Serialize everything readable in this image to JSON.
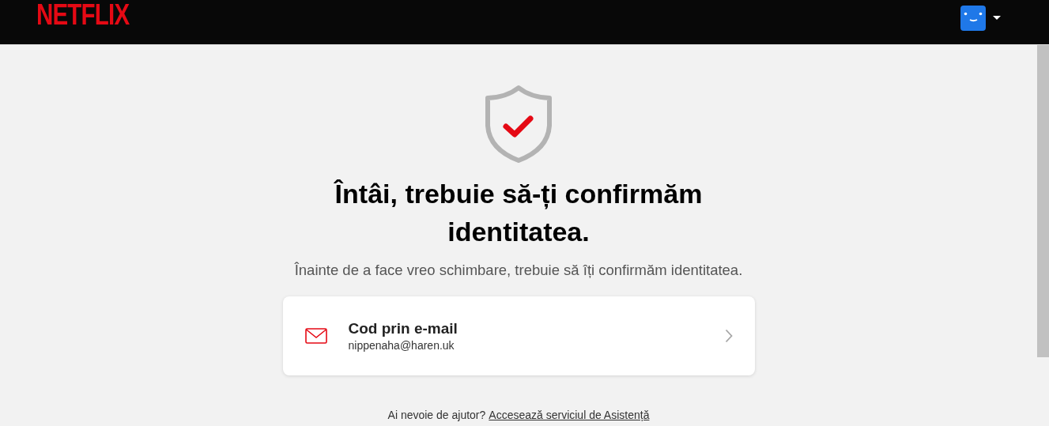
{
  "header": {
    "logo": "NETFLIX"
  },
  "title": "Întâi, trebuie să-ți confirmăm identitatea.",
  "subtitle": "Înainte de a face vreo schimbare, trebuie să îți confirmăm identitatea.",
  "options": [
    {
      "kind": "email",
      "label": "Cod prin e-mail",
      "detail": "nippenaha@haren.uk"
    }
  ],
  "help": {
    "text": "Ai nevoie de ajutor?",
    "link": "Accesează serviciul de Asistență"
  }
}
